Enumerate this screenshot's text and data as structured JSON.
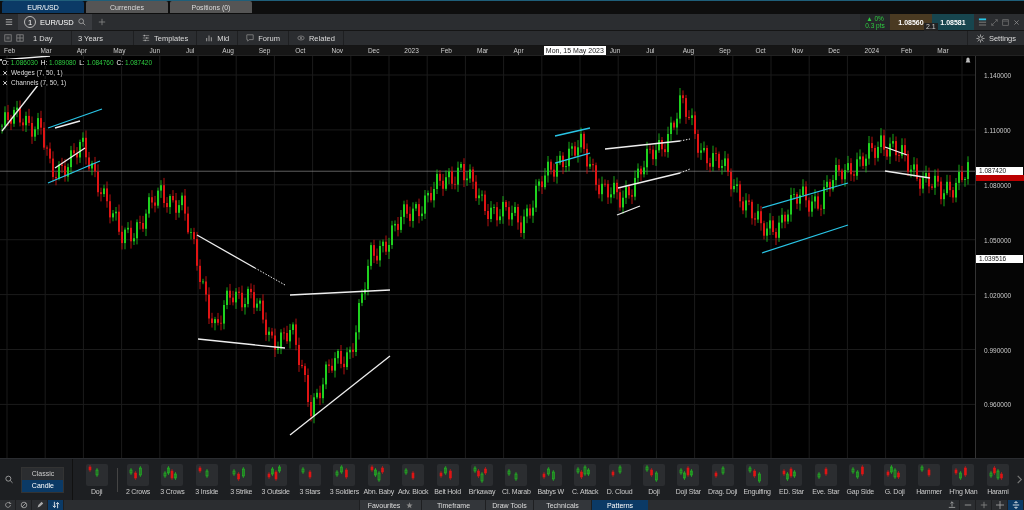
{
  "top_tabs": [
    {
      "label": "EUR/USD",
      "selected": true
    },
    {
      "label": "Currencies",
      "selected": false
    },
    {
      "label": "Positions (0)",
      "selected": false
    }
  ],
  "instrument_tab": {
    "index": "1",
    "symbol": "EUR/USD"
  },
  "quote": {
    "change": "▲ 0%",
    "points": "0.3 pts",
    "sell": "1.08560",
    "buy": "1.08581",
    "spread": "2.1"
  },
  "toolbar": {
    "timeframe": "1 Day",
    "range": "3 Years",
    "buttons": [
      {
        "kind": "templates",
        "label": "Templates"
      },
      {
        "kind": "mid",
        "label": "Mid"
      },
      {
        "kind": "forum",
        "label": "Forum"
      },
      {
        "kind": "related",
        "label": "Related"
      }
    ],
    "settings": "Settings"
  },
  "chart": {
    "time_axis": [
      {
        "kind": "month",
        "label": "Feb"
      },
      {
        "kind": "month",
        "label": "Mar"
      },
      {
        "kind": "month",
        "label": "Apr"
      },
      {
        "kind": "month",
        "label": "May"
      },
      {
        "kind": "month",
        "label": "Jun"
      },
      {
        "kind": "month",
        "label": "Jul"
      },
      {
        "kind": "month",
        "label": "Aug"
      },
      {
        "kind": "month",
        "label": "Sep"
      },
      {
        "kind": "month",
        "label": "Oct"
      },
      {
        "kind": "month",
        "label": "Nov"
      },
      {
        "kind": "month",
        "label": "Dec"
      },
      {
        "kind": "month",
        "label": "2023"
      },
      {
        "kind": "month",
        "label": "Feb"
      },
      {
        "kind": "month",
        "label": "Mar"
      },
      {
        "kind": "month",
        "label": "Apr"
      },
      {
        "kind": "cursor",
        "label": "Mon, 15 May 2023"
      },
      {
        "kind": "month",
        "label": "Jun"
      },
      {
        "kind": "month",
        "label": "Jul"
      },
      {
        "kind": "month",
        "label": "Aug"
      },
      {
        "kind": "month",
        "label": "Sep"
      },
      {
        "kind": "month",
        "label": "Oct"
      },
      {
        "kind": "month",
        "label": "Nov"
      },
      {
        "kind": "month",
        "label": "Dec"
      },
      {
        "kind": "month",
        "label": "2024"
      },
      {
        "kind": "month",
        "label": "Feb"
      },
      {
        "kind": "month",
        "label": "Mar"
      }
    ],
    "ohlc": [
      {
        "label": "O:",
        "value": "1.086030"
      },
      {
        "label": "H:",
        "value": "1.089080"
      },
      {
        "label": "L:",
        "value": "1.084760"
      },
      {
        "label": "C:",
        "value": "1.087420"
      }
    ],
    "indicators": [
      "Wedges (7, 50, 1)",
      "Channels (7, 50, 1)"
    ],
    "price_axis": [
      "1.140000",
      "1.110000",
      "1.080000",
      "1.050000",
      "1.020000",
      "0.990000",
      "0.960000"
    ],
    "last_price": "1.087420",
    "marker_price": "1.039516"
  },
  "pattern_bar": {
    "styles": [
      {
        "label": "Classic",
        "selected": false
      },
      {
        "label": "Candle",
        "selected": true
      }
    ],
    "patterns": [
      "Doji",
      "2 Crows",
      "3 Crows",
      "3 Inside",
      "3 Strike",
      "3 Outside",
      "3 Stars",
      "3 Soldiers",
      "Abn. Baby",
      "Adv. Block",
      "Belt Hold",
      "Br'kaway",
      "Cl. Marab",
      "Babys W",
      "C. Attack",
      "D. Cloud",
      "Doji",
      "Doji Star",
      "Drag. Doji",
      "Engulfing",
      "ED. Star",
      "Eve. Star",
      "Gap Side",
      "G. Doji",
      "Hammer",
      "H'ng Man",
      "Harami"
    ]
  },
  "bottom_tools": [
    {
      "kind": "refresh",
      "selected": false
    },
    {
      "kind": "block",
      "selected": false
    },
    {
      "kind": "pencil",
      "selected": false
    },
    {
      "kind": "arrows",
      "selected": true
    }
  ],
  "bottom_tabs": [
    {
      "label": "Favourites",
      "selected": false
    },
    {
      "label": "Timeframe",
      "selected": false
    },
    {
      "label": "Draw Tools",
      "selected": false
    },
    {
      "label": "Technicals",
      "selected": false
    },
    {
      "label": "Patterns",
      "selected": true
    }
  ],
  "view_tools": [
    {
      "kind": "move",
      "selected": false
    },
    {
      "kind": "minus",
      "selected": false
    },
    {
      "kind": "plus",
      "selected": false
    },
    {
      "kind": "crosshair",
      "selected": false
    },
    {
      "kind": "fit",
      "selected": true
    }
  ]
}
